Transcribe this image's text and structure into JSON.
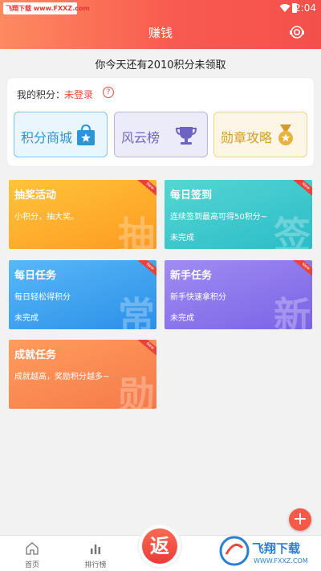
{
  "status_bar": {
    "watermark": "飞翔下载 www.FXXZ.com",
    "time": "2:04"
  },
  "header": {
    "title": "赚钱"
  },
  "notice": "你今天还有2010积分未领取",
  "points": {
    "label": "我的积分：",
    "value": "未登录",
    "help": "?",
    "features": [
      {
        "label": "积分商城",
        "icon": "shopping-bag-star-icon"
      },
      {
        "label": "风云榜",
        "icon": "trophy-icon"
      },
      {
        "label": "勋章攻略",
        "icon": "medal-icon"
      }
    ]
  },
  "tasks": [
    {
      "title": "抽奖活动",
      "desc": "小积分，抽大奖。",
      "status": "",
      "big": "抽",
      "ribbon": "New"
    },
    {
      "title": "每日签到",
      "desc": "连续签到最高可得50积分~",
      "status": "未完成",
      "big": "签",
      "ribbon": "New"
    },
    {
      "title": "每日任务",
      "desc": "每日轻松得积分",
      "status": "未完成",
      "big": "常",
      "ribbon": "New"
    },
    {
      "title": "新手任务",
      "desc": "新手快速拿积分",
      "status": "未完成",
      "big": "新",
      "ribbon": "New"
    },
    {
      "title": "成就任务",
      "desc": "成就越高，奖励积分越多~",
      "status": "",
      "big": "勋",
      "ribbon": "New"
    }
  ],
  "fab": "+",
  "tabbar": {
    "home": "首页",
    "rank": "排行榜",
    "center": "返"
  },
  "logo_watermark": {
    "name": "飞翔下载",
    "url": "WWW.FXXZ.COM"
  },
  "colors": {
    "accent": "#f85a4f",
    "red_text": "#e84a3e"
  }
}
